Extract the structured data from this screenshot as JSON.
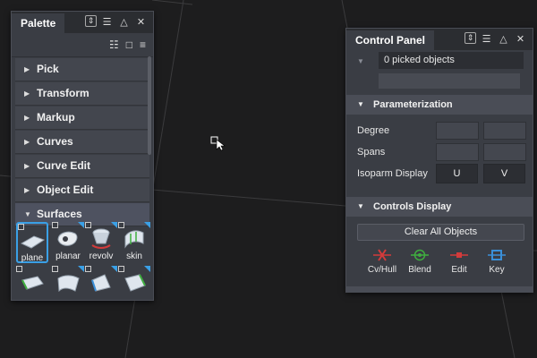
{
  "palette": {
    "title": "Palette",
    "sections": [
      {
        "label": "Pick",
        "open": false
      },
      {
        "label": "Transform",
        "open": false
      },
      {
        "label": "Markup",
        "open": false
      },
      {
        "label": "Curves",
        "open": false
      },
      {
        "label": "Curve Edit",
        "open": false
      },
      {
        "label": "Object Edit",
        "open": false
      },
      {
        "label": "Surfaces",
        "open": true
      }
    ],
    "tools": [
      {
        "label": "plane",
        "icon": "plane-surface-icon",
        "selected": true
      },
      {
        "label": "planar",
        "icon": "planar-surface-icon"
      },
      {
        "label": "revolv",
        "icon": "revolve-surface-icon"
      },
      {
        "label": "skin",
        "icon": "skin-surface-icon"
      }
    ]
  },
  "control_panel": {
    "title": "Control Panel",
    "picked": "0 picked objects",
    "parameterization": {
      "title": "Parameterization",
      "degree_label": "Degree",
      "spans_label": "Spans",
      "isoparm_label": "Isoparm Display",
      "u_button": "U",
      "v_button": "V"
    },
    "controls_display": {
      "title": "Controls Display",
      "clear_button": "Clear All Objects",
      "items": [
        {
          "label": "Cv/Hull",
          "icon": "cv-hull-icon",
          "color": "#d33b3b"
        },
        {
          "label": "Blend",
          "icon": "blend-icon",
          "color": "#3fae3f"
        },
        {
          "label": "Edit",
          "icon": "edit-point-icon",
          "color": "#d33b3b"
        },
        {
          "label": "Key",
          "icon": "key-point-icon",
          "color": "#3a8fd8"
        }
      ]
    }
  },
  "colors": {
    "background": "#1d1d1e",
    "panel": "#3a3d44",
    "accent": "#3aa0e6"
  }
}
